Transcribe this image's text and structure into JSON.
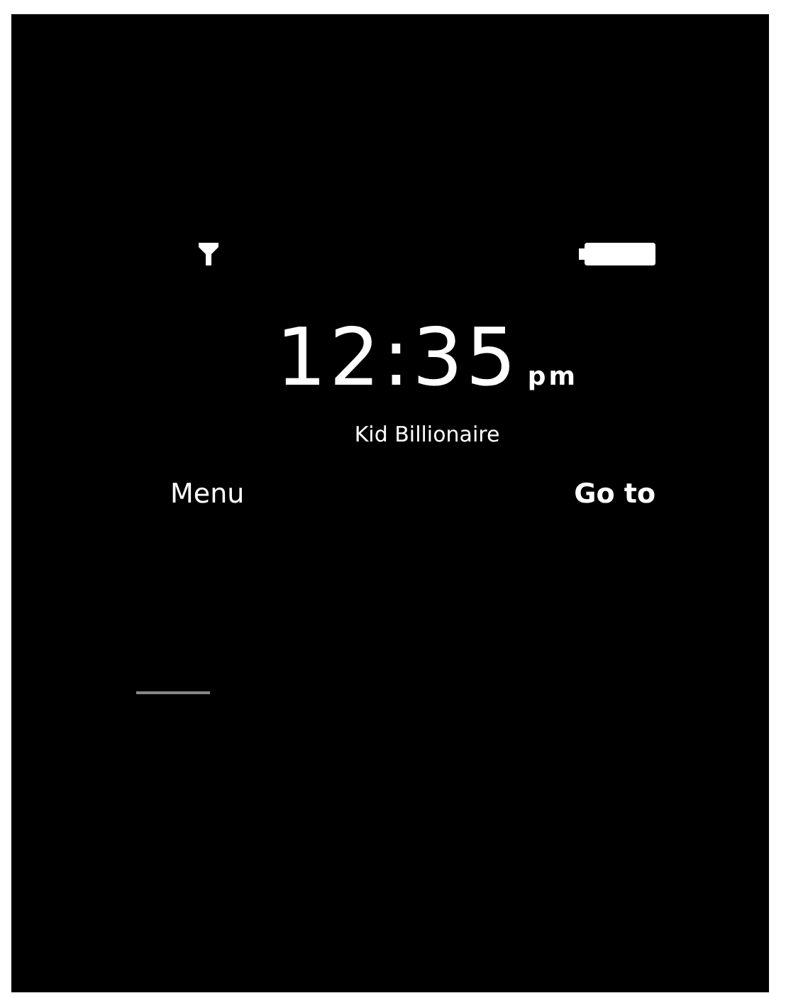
{
  "clock": {
    "time": "12:35",
    "meridiem": "pm"
  },
  "operator": "Kid Billionaire",
  "softkeys": [
    {
      "label": "Menu"
    },
    {
      "label": "Go to"
    }
  ]
}
